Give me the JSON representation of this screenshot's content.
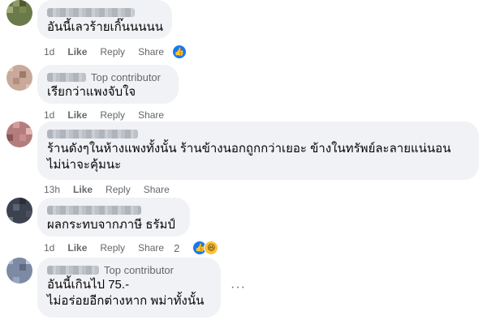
{
  "comments": [
    {
      "badge": "",
      "lines": [
        "อันนี้เลวร้ายเกิ๊นนนนน"
      ],
      "time": "1d",
      "like": "Like",
      "reply": "Share_placeholder"
    }
  ],
  "c1": {
    "text1": "อันนี้เลวร้ายเกิ๊นนนนน",
    "time": "1d",
    "like": "Like",
    "reply": "Reply",
    "share": "Share",
    "reaction_icon": "like-icon"
  },
  "c2": {
    "badge": "Top contributor",
    "text1": "เรียกว่าแพงจับใจ",
    "time": "1d",
    "like": "Like",
    "reply": "Reply",
    "share": "Share"
  },
  "c3": {
    "text1": "ร้านดังๆในห้างแพงทั้งนั้น ร้านข้างนอกถูกกว่าเยอะ ข้างในทรัพย์ละลายแน่นอน",
    "text2": "ไม่น่าจะคุ้มนะ",
    "time": "13h",
    "like": "Like",
    "reply": "Reply",
    "share": "Share"
  },
  "c4": {
    "text1": "ผลกระทบจากภาษี ธรัมป์",
    "time": "1d",
    "like": "Like",
    "reply": "Reply",
    "share": "Share",
    "reaction_count": "2",
    "reaction_icons": [
      "like-icon",
      "haha-icon"
    ]
  },
  "c5": {
    "badge": "Top contributor",
    "text1": "อันนี้เกินไป 75.-",
    "text2": "ไม่อร่อยอีกต่างหาก พม่าทั้งนั้น",
    "more": "···"
  }
}
